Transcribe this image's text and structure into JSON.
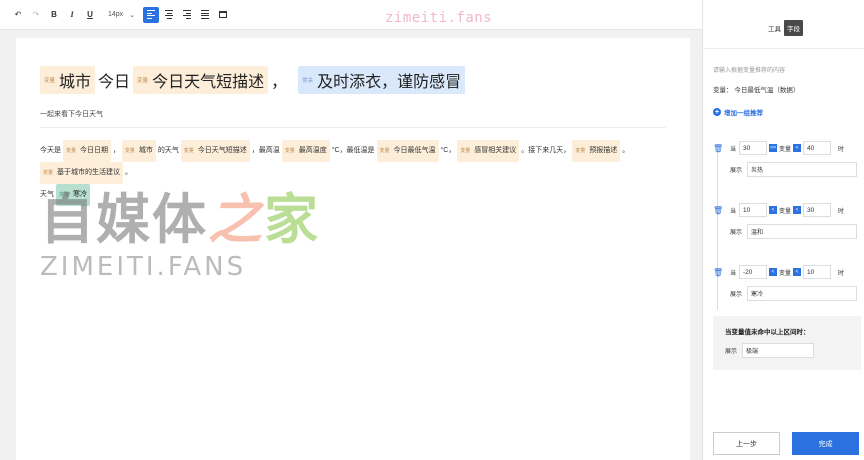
{
  "toolbar": {
    "undo": "↶",
    "redo": "↷",
    "bold": "B",
    "italic": "I",
    "underline": "U",
    "font_size": "14px"
  },
  "watermark": {
    "top": "zimeiti.fans",
    "cn_a": "自媒体",
    "cn_b": "之",
    "cn_c": "家",
    "en": "ZIMEITI.FANS"
  },
  "doc": {
    "var_tag": "变量",
    "const_tag": "常关",
    "title": {
      "var1": "城市",
      "plain1": "今日",
      "var2": "今日天气短描述",
      "plain2": "，",
      "const1": "及时添衣，谨防感冒"
    },
    "subtitle": "一起来看下今日天气",
    "para": {
      "t1": "今天是",
      "v1": "今日日期",
      "t2": "，",
      "v2": "城市",
      "t3": "的天气",
      "v3": "今日天气短描述",
      "t4": "，最高温",
      "v4": "最高温度",
      "t5": "°C，最低温是",
      "v5": "今日最低气温",
      "t6": "°C，",
      "v6": "感冒相关建议",
      "t7": "。接下来几天，",
      "v7": "预报描述",
      "t8": "。",
      "v8": "基于城市的生活建议",
      "t9": "。",
      "t10": "天气",
      "v9": "寒冷"
    }
  },
  "panel": {
    "tab_tool": "工具",
    "tab_field": "字段",
    "hint": "请输入根据变量推荐的内容",
    "var_label": "变量：",
    "var_value": "今日最低气温（数据）",
    "add_rec": "增加一组推荐",
    "when": "当",
    "var_word": "变量",
    "then": "时",
    "show": "展示",
    "rules": [
      {
        "low": "30",
        "op1": "<=",
        "op2": "<",
        "high": "40",
        "display": "炎热"
      },
      {
        "low": "10",
        "op1": "<",
        "op2": "<",
        "high": "30",
        "display": "温和"
      },
      {
        "low": "-20",
        "op1": "<",
        "op2": "<",
        "high": "10",
        "display": "寒冷"
      }
    ],
    "fallback_title": "当变量值未命中以上区间时：",
    "fallback_value": "极端",
    "prev": "上一步",
    "done": "完成"
  }
}
